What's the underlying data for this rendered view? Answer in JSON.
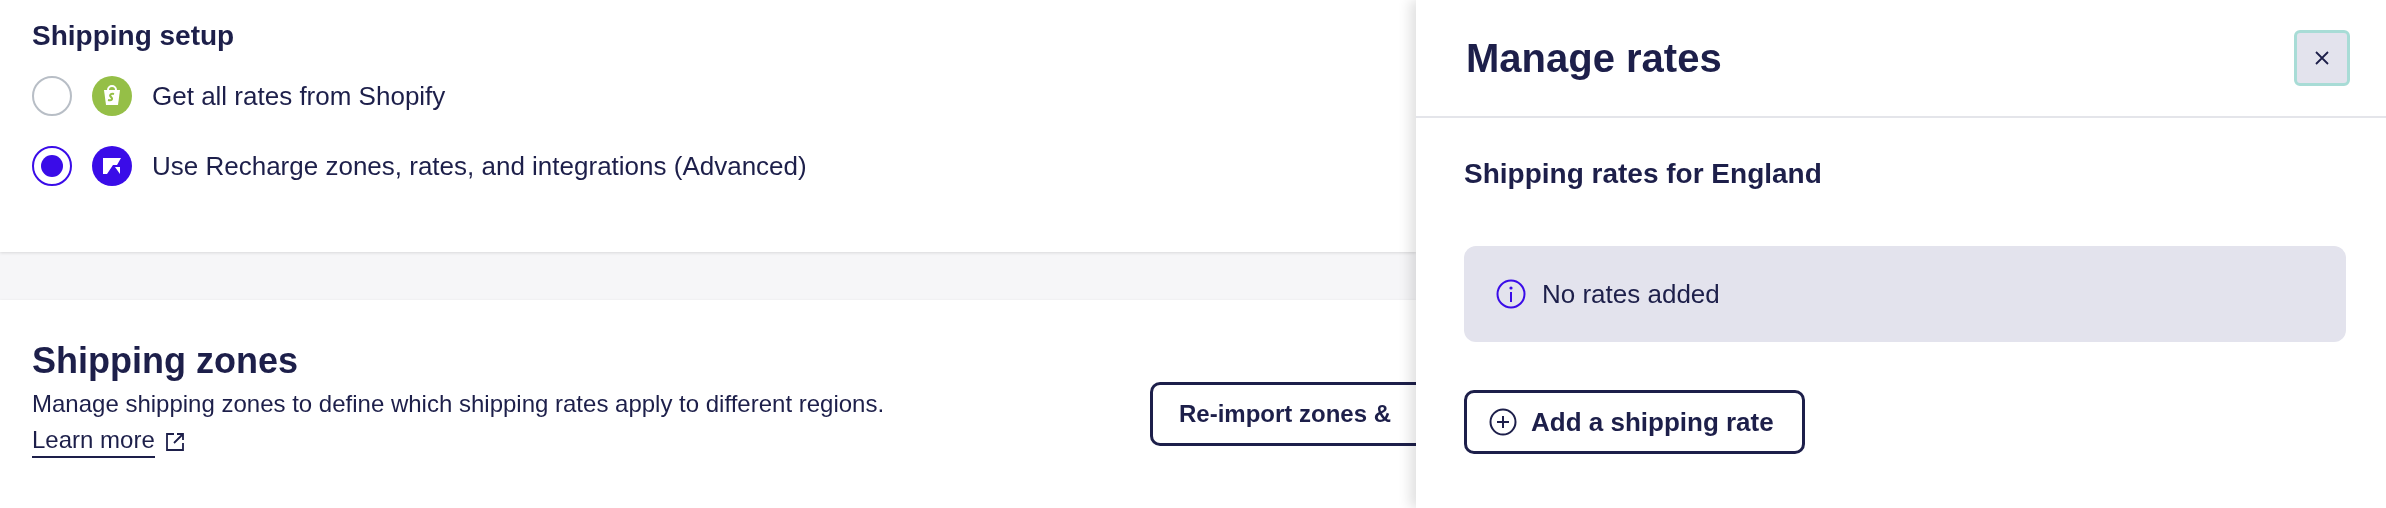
{
  "shipping_setup": {
    "title": "Shipping setup",
    "options": [
      {
        "label": "Get all rates from Shopify",
        "kind": "shopify",
        "selected": false
      },
      {
        "label": "Use Recharge zones, rates, and integrations (Advanced)",
        "kind": "recharge",
        "selected": true
      }
    ]
  },
  "shipping_zones": {
    "title": "Shipping zones",
    "description": "Manage shipping zones to define which shipping rates apply to different regions.",
    "link": "Learn more",
    "button": "Re-import zones &"
  },
  "panel": {
    "title": "Manage rates",
    "section_title": "Shipping rates for England",
    "notice": "No rates added",
    "add_button": "Add a shipping rate"
  }
}
